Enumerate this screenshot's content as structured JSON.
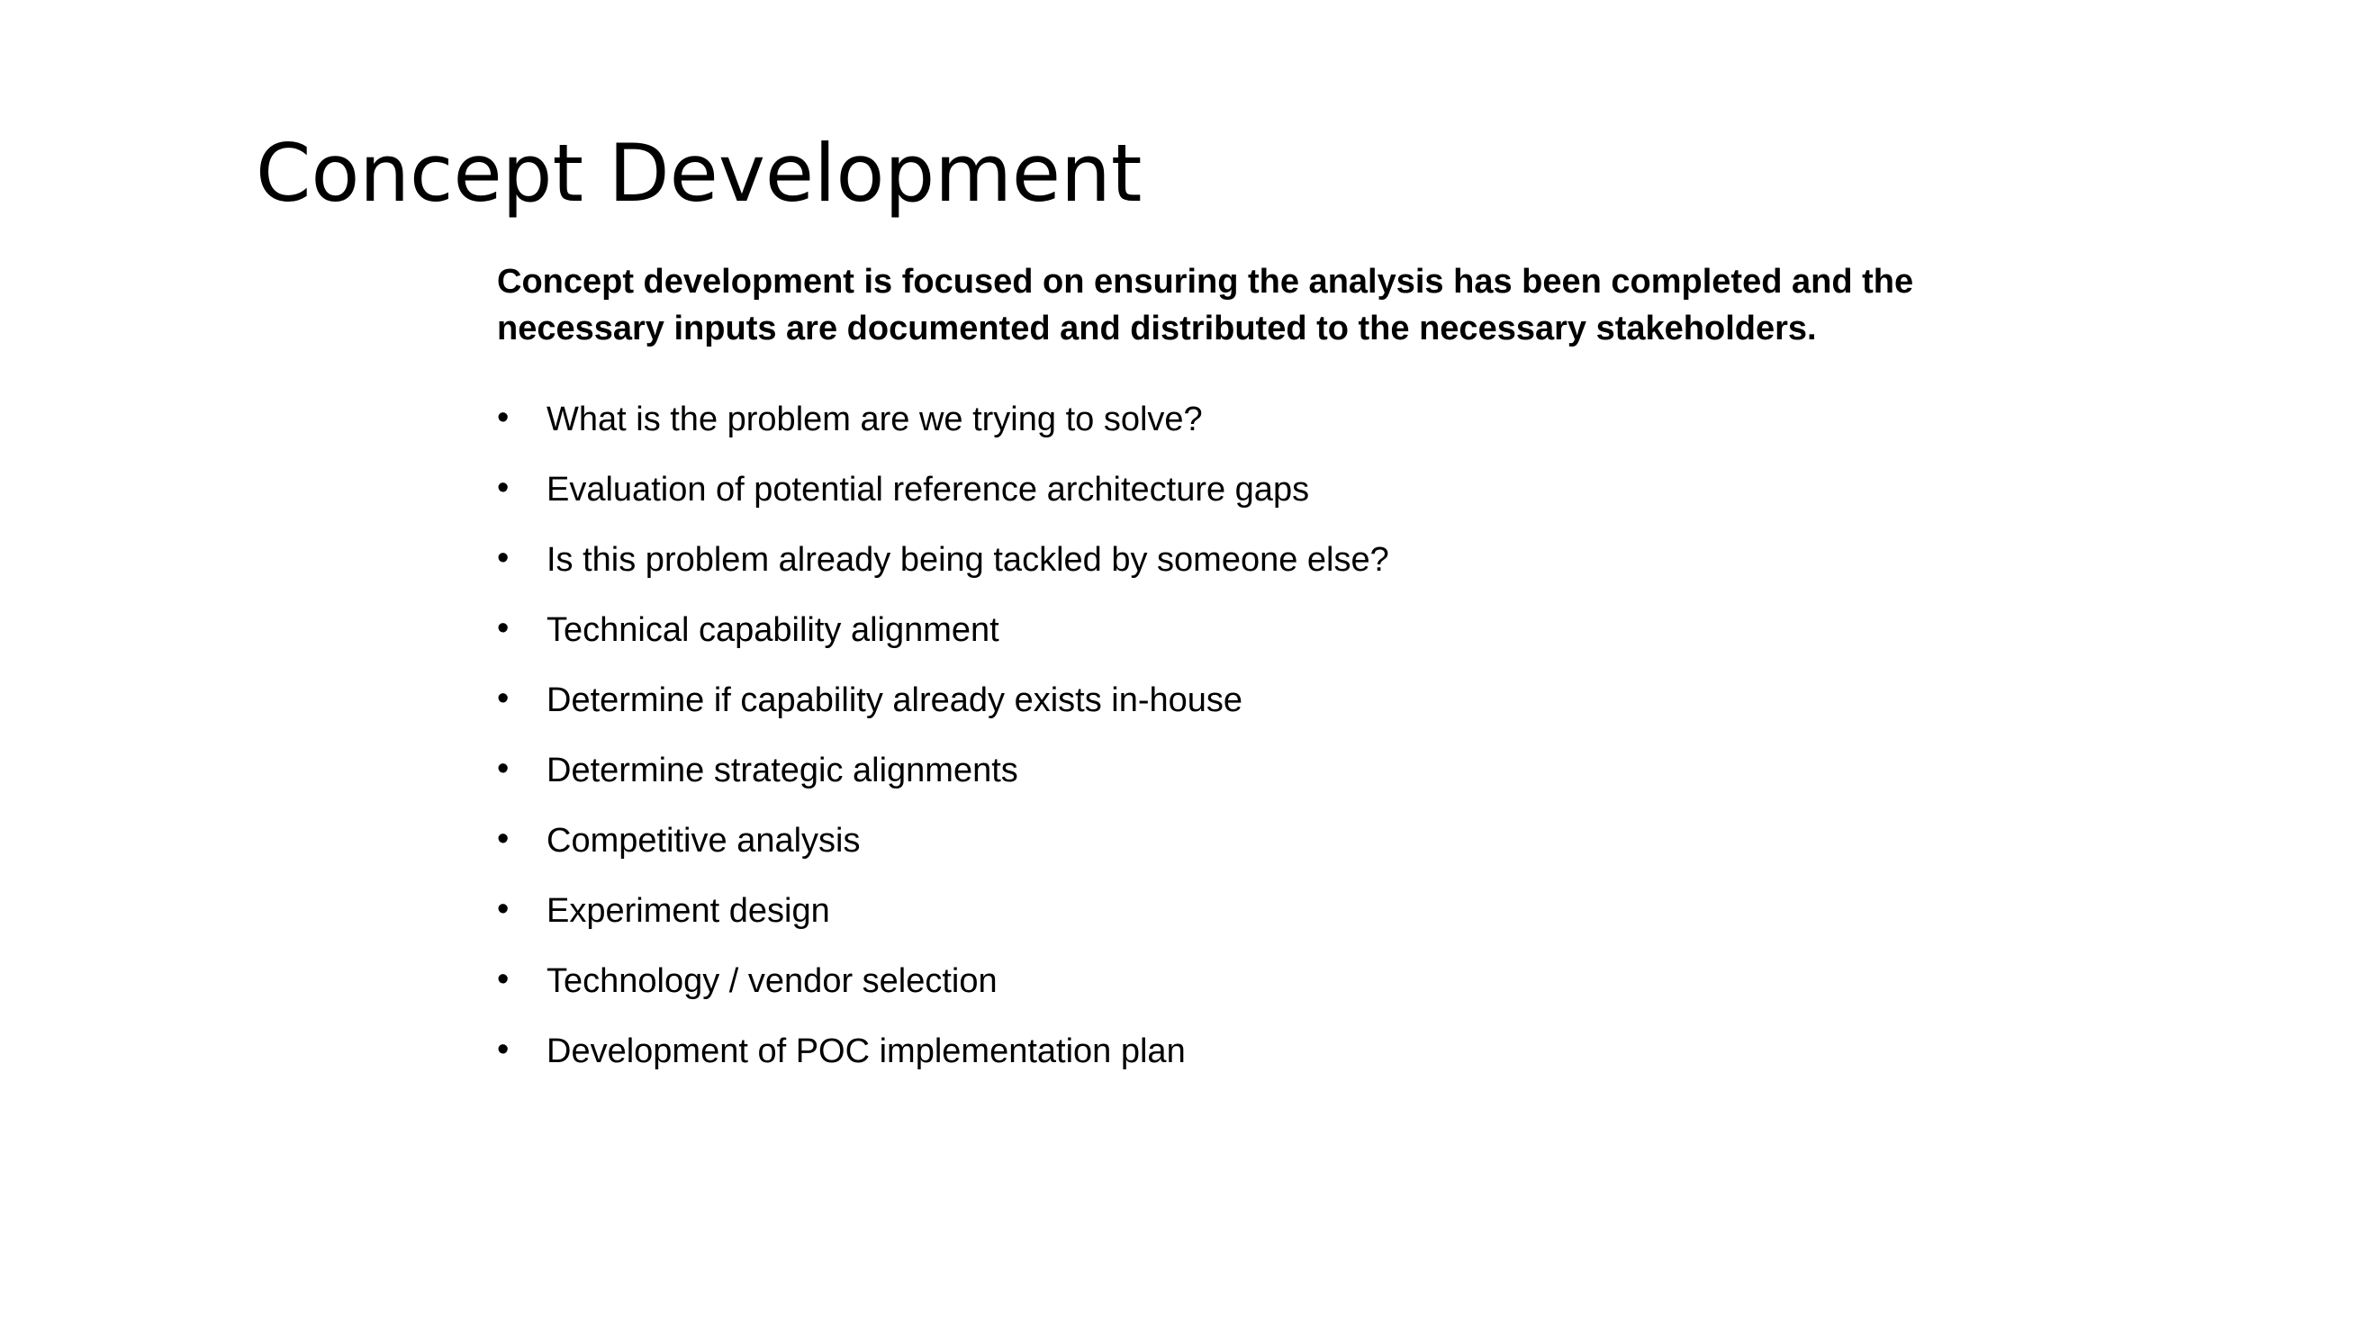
{
  "slide": {
    "title": "Concept Development",
    "intro": "Concept development is focused on ensuring the analysis has been completed and the necessary inputs are documented and distributed to the necessary stakeholders.",
    "bullet_glyph": "•",
    "bullets": [
      "What is the problem are we trying to solve?",
      "Evaluation of potential reference architecture gaps",
      "Is this problem already being tackled by someone else?",
      "Technical capability alignment",
      "Determine if capability already exists in-house",
      "Determine strategic alignments",
      "Competitive analysis",
      "Experiment design",
      "Technology / vendor selection",
      "Development of POC implementation plan"
    ]
  }
}
